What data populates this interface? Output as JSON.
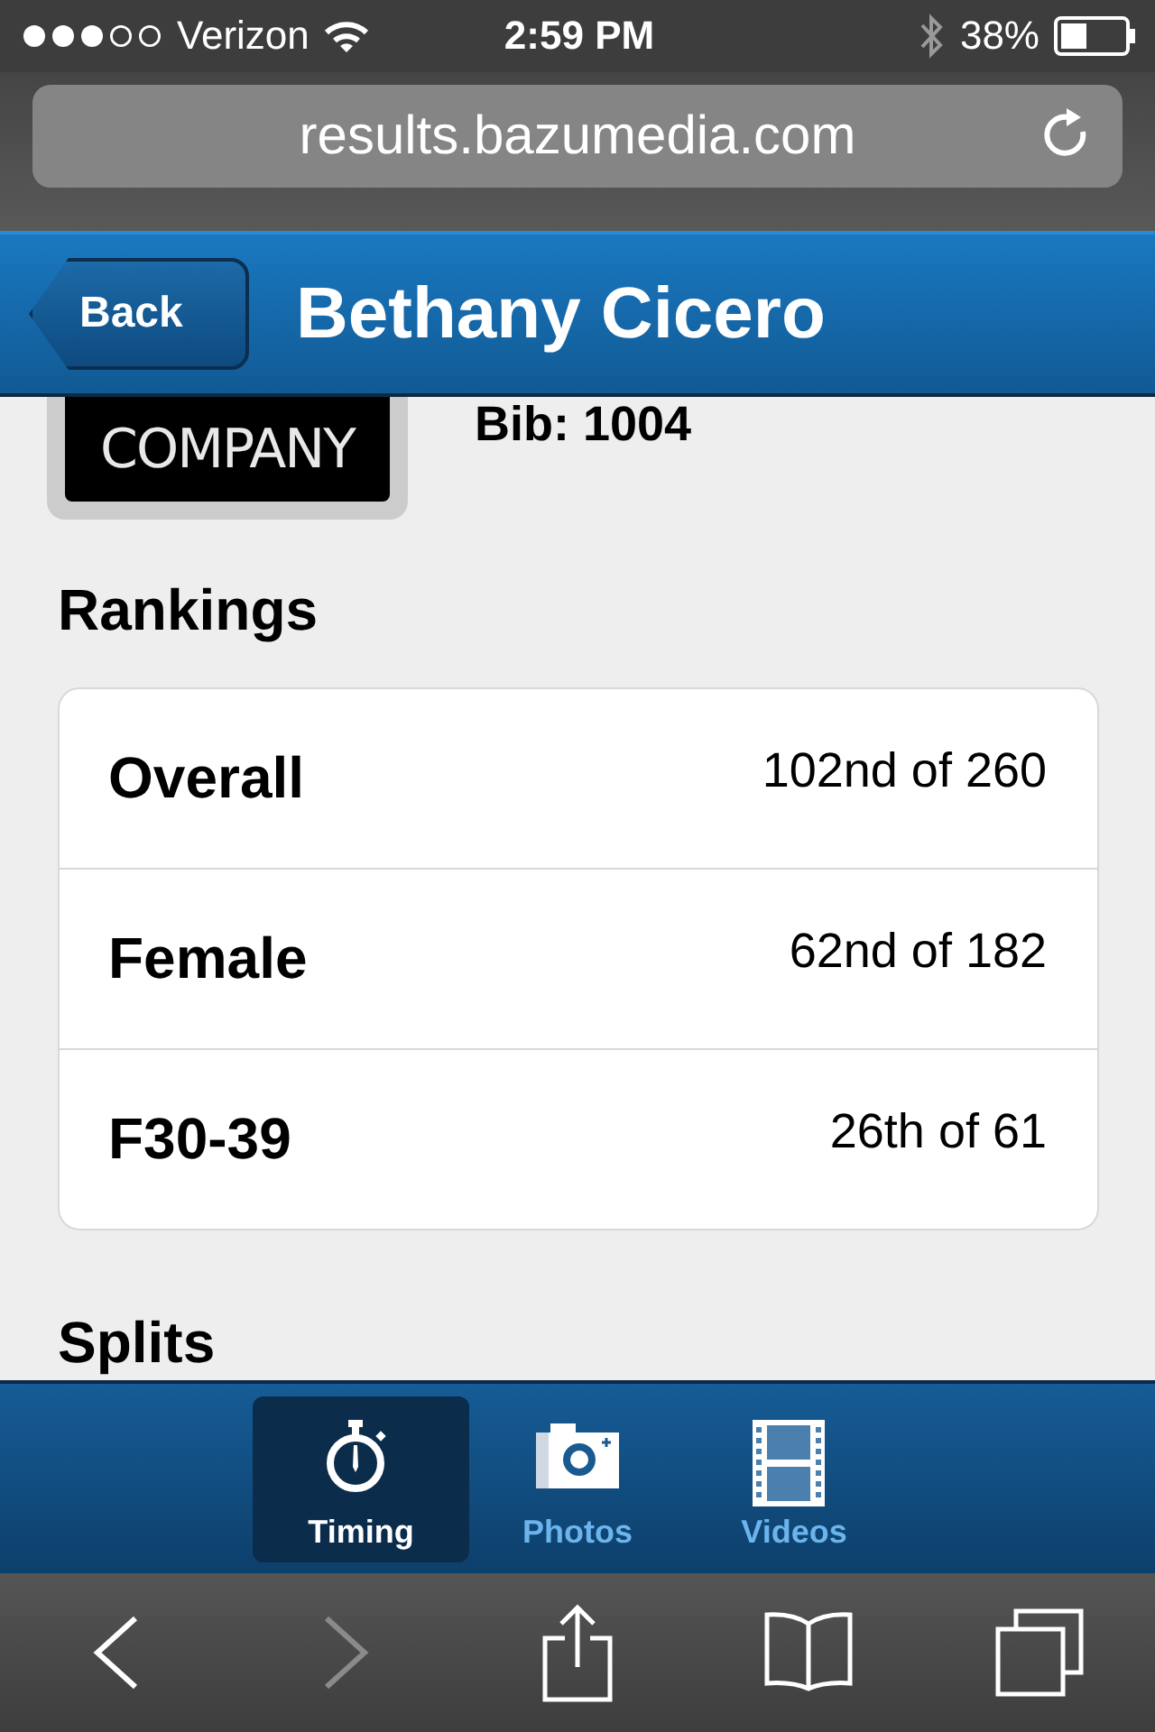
{
  "status_bar": {
    "carrier": "Verizon",
    "time": "2:59 PM",
    "battery": "38%"
  },
  "browser": {
    "url": "results.bazumedia.com"
  },
  "header": {
    "back": "Back",
    "title": "Bethany Cicero"
  },
  "athlete": {
    "logo": "COMPANY",
    "bib": "Bib: 1004"
  },
  "rankings": {
    "heading": "Rankings",
    "rows": [
      {
        "label": "Overall",
        "value": "102nd of 260"
      },
      {
        "label": "Female",
        "value": "62nd of 182"
      },
      {
        "label": "F30-39",
        "value": "26th of 61"
      }
    ]
  },
  "splits": {
    "heading": "Splits"
  },
  "tabs": [
    {
      "kind": "timing",
      "label": "Timing",
      "selected": true
    },
    {
      "kind": "photos",
      "label": "Photos",
      "selected": false
    },
    {
      "kind": "videos",
      "label": "Videos",
      "selected": false
    }
  ],
  "toolbar": [
    {
      "kind": "back",
      "disabled": false
    },
    {
      "kind": "forward",
      "disabled": true
    },
    {
      "kind": "share",
      "disabled": false
    },
    {
      "kind": "bookmarks",
      "disabled": false
    },
    {
      "kind": "tabs",
      "disabled": false
    }
  ]
}
